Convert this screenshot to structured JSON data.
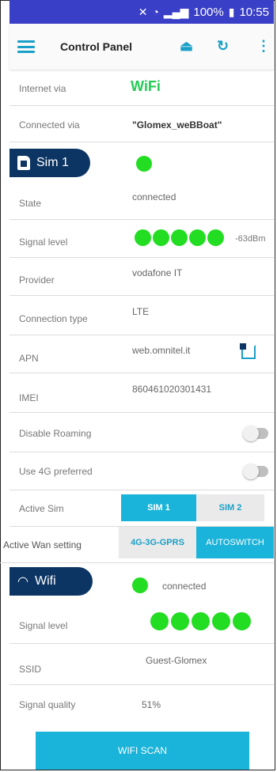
{
  "status_bar": {
    "battery": "100%",
    "time": "10:55"
  },
  "app_bar": {
    "title": "Control Panel"
  },
  "internet": {
    "via_label": "Internet via",
    "via_value": "WiFi",
    "connected_label": "Connected via",
    "connected_value": "\"Glomex_weBBoat\""
  },
  "sim": {
    "header": "Sim 1",
    "state_label": "State",
    "state_value": "connected",
    "signal_label": "Signal level",
    "signal_value": "-63dBm",
    "signal_bars": 5,
    "provider_label": "Provider",
    "provider_value": "vodafone IT",
    "conn_type_label": "Connection type",
    "conn_type_value": "LTE",
    "apn_label": "APN",
    "apn_value": "web.omnitel.it",
    "imei_label": "IMEI",
    "imei_value": "860461020301431",
    "roaming_label": "Disable Roaming",
    "use4g_label": "Use 4G preferred",
    "active_sim_label": "Active Sim",
    "sim1_label": "SIM 1",
    "sim2_label": "SIM 2"
  },
  "wan": {
    "label": "Active Wan setting",
    "opt1": "4G-3G-GPRS",
    "opt2": "AUTOSWITCH"
  },
  "wifi": {
    "header": "Wifi",
    "status": "connected",
    "signal_label": "Signal level",
    "signal_bars": 5,
    "ssid_label": "SSID",
    "ssid_value": "Guest-Glomex",
    "quality_label": "Signal quality",
    "quality_value": "51%",
    "scan_label": "WIFI SCAN"
  },
  "colors": {
    "accent": "#1ab3d9",
    "pill": "#0d3563",
    "green": "#22dd22",
    "statusbar": "#3a3fc7"
  }
}
